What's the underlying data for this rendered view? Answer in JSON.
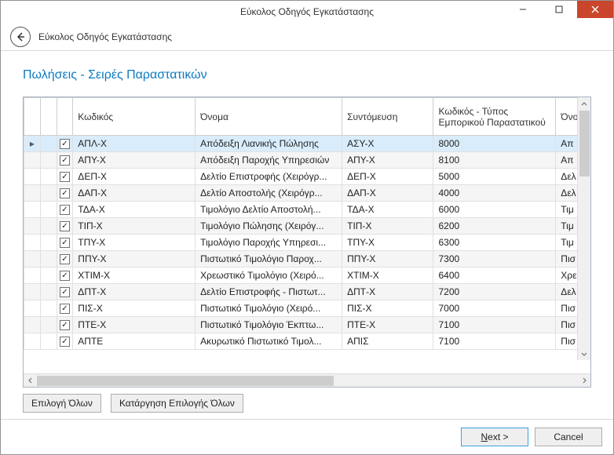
{
  "window": {
    "title": "Εύκολος Οδηγός Εγκατάστασης"
  },
  "header": {
    "title": "Εύκολος Οδηγός Εγκατάστασης"
  },
  "page": {
    "title": "Πωλήσεις - Σειρές Παραστατικών"
  },
  "grid": {
    "columns": {
      "code": "Κωδικός",
      "name": "Όνομα",
      "short": "Συντόμευση",
      "doc": "Κωδικός - Τύπος Εμπορικού Παραστατικού",
      "name2": "Όνομα"
    },
    "rows": [
      {
        "selected": true,
        "checked": true,
        "code": "ΑΠΛ-Χ",
        "name": "Απόδειξη Λιανικής Πώλησης",
        "short": "ΑΣΥ-Χ",
        "doc": "8000",
        "name2": "Απ"
      },
      {
        "selected": false,
        "checked": true,
        "code": "ΑΠΥ-Χ",
        "name": "Απόδειξη Παροχής Υπηρεσιών",
        "short": "ΑΠΥ-Χ",
        "doc": "8100",
        "name2": "Απ"
      },
      {
        "selected": false,
        "checked": true,
        "code": "ΔΕΠ-Χ",
        "name": "Δελτίο Επιστροφής (Χειρόγρ...",
        "short": "ΔΕΠ-Χ",
        "doc": "5000",
        "name2": "Δελ"
      },
      {
        "selected": false,
        "checked": true,
        "code": "ΔΑΠ-Χ",
        "name": "Δελτίο Αποστολής (Χειρόγρ...",
        "short": "ΔΑΠ-Χ",
        "doc": "4000",
        "name2": "Δελ"
      },
      {
        "selected": false,
        "checked": true,
        "code": "ΤΔΑ-Χ",
        "name": "Τιμολόγιο Δελτίο Αποστολή...",
        "short": "ΤΔΑ-Χ",
        "doc": "6000",
        "name2": "Τιμ"
      },
      {
        "selected": false,
        "checked": true,
        "code": "ΤΙΠ-Χ",
        "name": "Τιμολόγιο Πώλησης (Χειρόγ...",
        "short": "ΤΙΠ-Χ",
        "doc": "6200",
        "name2": "Τιμ"
      },
      {
        "selected": false,
        "checked": true,
        "code": "ΤΠΥ-Χ",
        "name": "Τιμολόγιο Παροχής Υπηρεσι...",
        "short": "ΤΠΥ-Χ",
        "doc": "6300",
        "name2": "Τιμ"
      },
      {
        "selected": false,
        "checked": true,
        "code": "ΠΠΥ-Χ",
        "name": "Πιστωτικό Τιμολόγιο Παροχ...",
        "short": "ΠΠΥ-Χ",
        "doc": "7300",
        "name2": "Πισ"
      },
      {
        "selected": false,
        "checked": true,
        "code": "ΧΤΙΜ-Χ",
        "name": "Χρεωστικό Τιμολόγιο (Χειρό...",
        "short": "ΧΤΙΜ-Χ",
        "doc": "6400",
        "name2": "Χρε"
      },
      {
        "selected": false,
        "checked": true,
        "code": "ΔΠΤ-Χ",
        "name": "Δελτίο Επιστροφής - Πιστωτ...",
        "short": "ΔΠΤ-Χ",
        "doc": "7200",
        "name2": "Δελ"
      },
      {
        "selected": false,
        "checked": true,
        "code": "ΠΙΣ-Χ",
        "name": "Πιστωτικό Τιμολόγιο (Χειρό...",
        "short": "ΠΙΣ-Χ",
        "doc": "7000",
        "name2": "Πισ"
      },
      {
        "selected": false,
        "checked": true,
        "code": "ΠΤΕ-Χ",
        "name": "Πιστωτικό Τιμολόγιο Έκπτω...",
        "short": "ΠΤΕ-Χ",
        "doc": "7100",
        "name2": "Πισ"
      },
      {
        "selected": false,
        "checked": true,
        "code": "ΑΠΤΕ",
        "name": "Ακυρωτικό Πιστωτικό Τιμολ...",
        "short": "ΑΠΙΣ",
        "doc": "7100",
        "name2": "Πισ"
      }
    ]
  },
  "buttons": {
    "select_all": "Επιλογή Όλων",
    "deselect_all": "Κατάργηση Επιλογής Όλων",
    "next": "Next >",
    "cancel": "Cancel"
  }
}
